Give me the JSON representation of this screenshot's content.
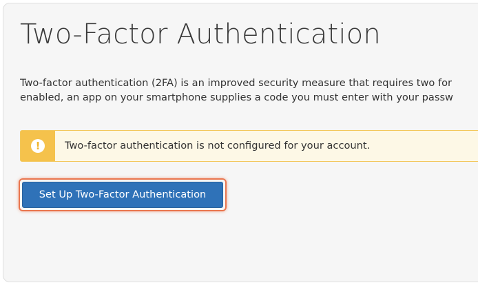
{
  "page": {
    "title": "Two-Factor Authentication",
    "description_lines": [
      "Two-factor authentication (2FA) is an improved security measure that requires two for",
      "enabled, an app on your smartphone supplies a code you must enter with your passw"
    ]
  },
  "alert": {
    "icon": "exclamation-icon",
    "icon_glyph": "!",
    "message": "Two-factor authentication is not configured for your account.",
    "color": "#f5c24c",
    "background": "#fdf8e6"
  },
  "actions": {
    "setup_label": "Set Up Two-Factor Authentication",
    "setup_color": "#2f72b8",
    "focus_ring_color": "#e9764f"
  }
}
